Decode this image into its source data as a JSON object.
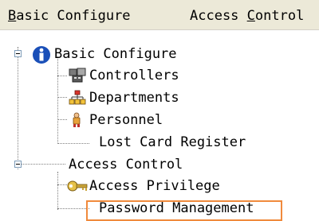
{
  "menu": {
    "items": [
      {
        "prefix": "",
        "underline": "B",
        "rest": "asic Configure"
      },
      {
        "prefix": "Access ",
        "underline": "C",
        "rest": "ontrol"
      }
    ]
  },
  "tree": {
    "root1": {
      "label": "Basic Configure",
      "icon": "info-icon"
    },
    "controllers": {
      "label": "Controllers",
      "icon": "controllers-icon"
    },
    "departments": {
      "label": "Departments",
      "icon": "departments-icon"
    },
    "personnel": {
      "label": "Personnel",
      "icon": "person-icon"
    },
    "lost_card": {
      "label": "Lost Card Register"
    },
    "root2": {
      "label": "Access Control"
    },
    "access_privilege": {
      "label": "Access Privilege",
      "icon": "key-icon"
    },
    "password_mgmt": {
      "label": "Password Management"
    }
  },
  "colors": {
    "menubar": "#ece9d8",
    "selection_border": "#f08a3c",
    "info_blue": "#1a4fb8"
  }
}
